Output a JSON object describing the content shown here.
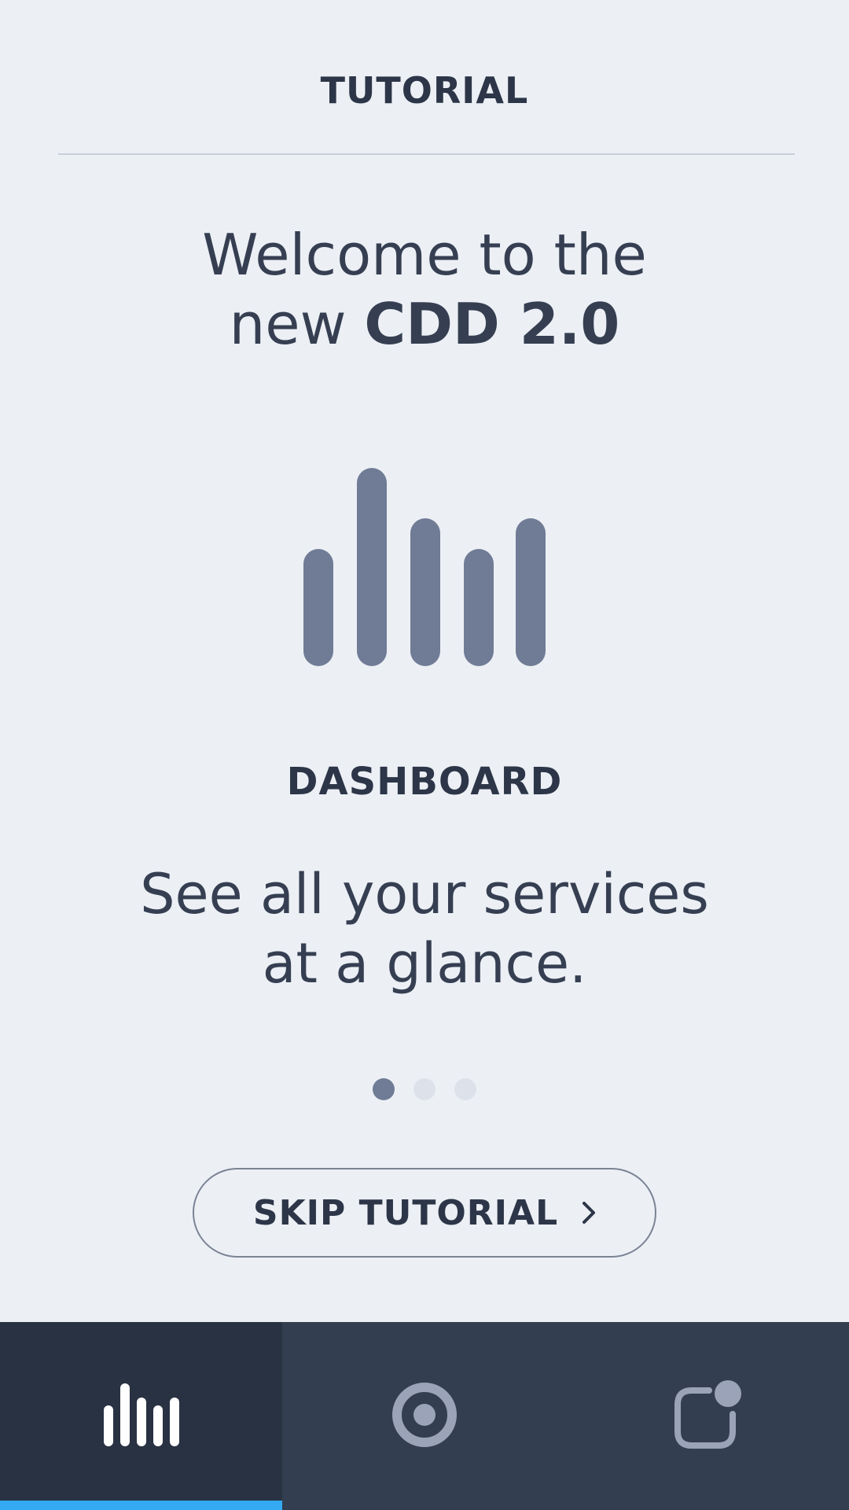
{
  "header": {
    "title": "TUTORIAL"
  },
  "welcome": {
    "line1": "Welcome to the",
    "line2_prefix": "new ",
    "line2_bold": "CDD 2.0"
  },
  "slide": {
    "icon": "bar-chart-icon",
    "title": "DASHBOARD",
    "description_line1": "See all your services",
    "description_line2": "at a glance."
  },
  "pagination": {
    "total": 3,
    "active_index": 0
  },
  "skip_button": {
    "label": "SKIP TUTORIAL",
    "icon": "chevron-right-icon"
  },
  "bottom_nav": {
    "tabs": [
      {
        "icon": "dashboard-bars-icon",
        "active": true
      },
      {
        "icon": "target-circle-icon",
        "active": false
      },
      {
        "icon": "notification-square-icon",
        "active": false
      }
    ],
    "active_indicator_color": "#33aaf2"
  },
  "colors": {
    "background": "#ecf0f5",
    "text": "#363f52",
    "icon": "#707b95",
    "nav_background": "#343e51",
    "nav_active_background": "#293242"
  }
}
